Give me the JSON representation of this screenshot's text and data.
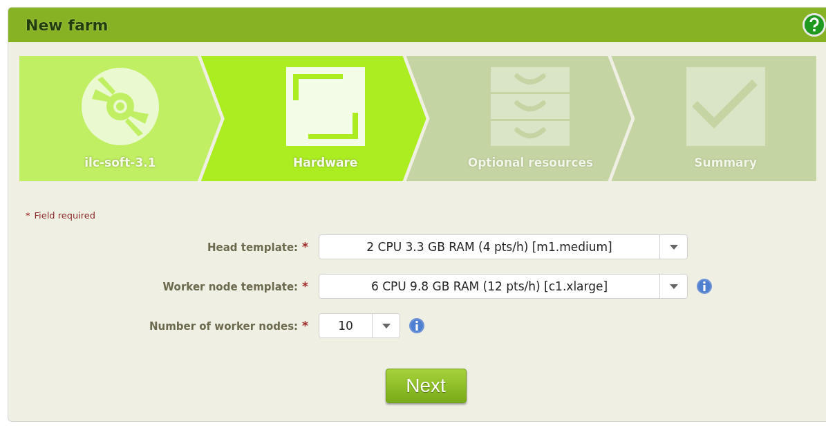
{
  "panel": {
    "title": "New farm"
  },
  "steps": [
    {
      "label": "ilc-soft-3.1",
      "selected": false,
      "disabled": false
    },
    {
      "label": "Hardware",
      "selected": true,
      "disabled": false
    },
    {
      "label": "Optional resources",
      "selected": false,
      "disabled": true
    },
    {
      "label": "Summary",
      "selected": false,
      "disabled": true
    }
  ],
  "required_note": {
    "mark": "*",
    "text": "Field required"
  },
  "fields": [
    {
      "label": "Head template:",
      "required": true,
      "value": "2 CPU 3.3 GB RAM (4 pts/h) [m1.medium]",
      "kind": "template",
      "info": false
    },
    {
      "label": "Worker node template:",
      "required": true,
      "value": "6 CPU 9.8 GB RAM (12 pts/h) [c1.xlarge]",
      "kind": "template",
      "info": true
    },
    {
      "label": "Number of worker nodes:",
      "required": true,
      "value": "10",
      "kind": "count",
      "info": true
    }
  ],
  "buttons": [
    {
      "label": "Next"
    }
  ]
}
